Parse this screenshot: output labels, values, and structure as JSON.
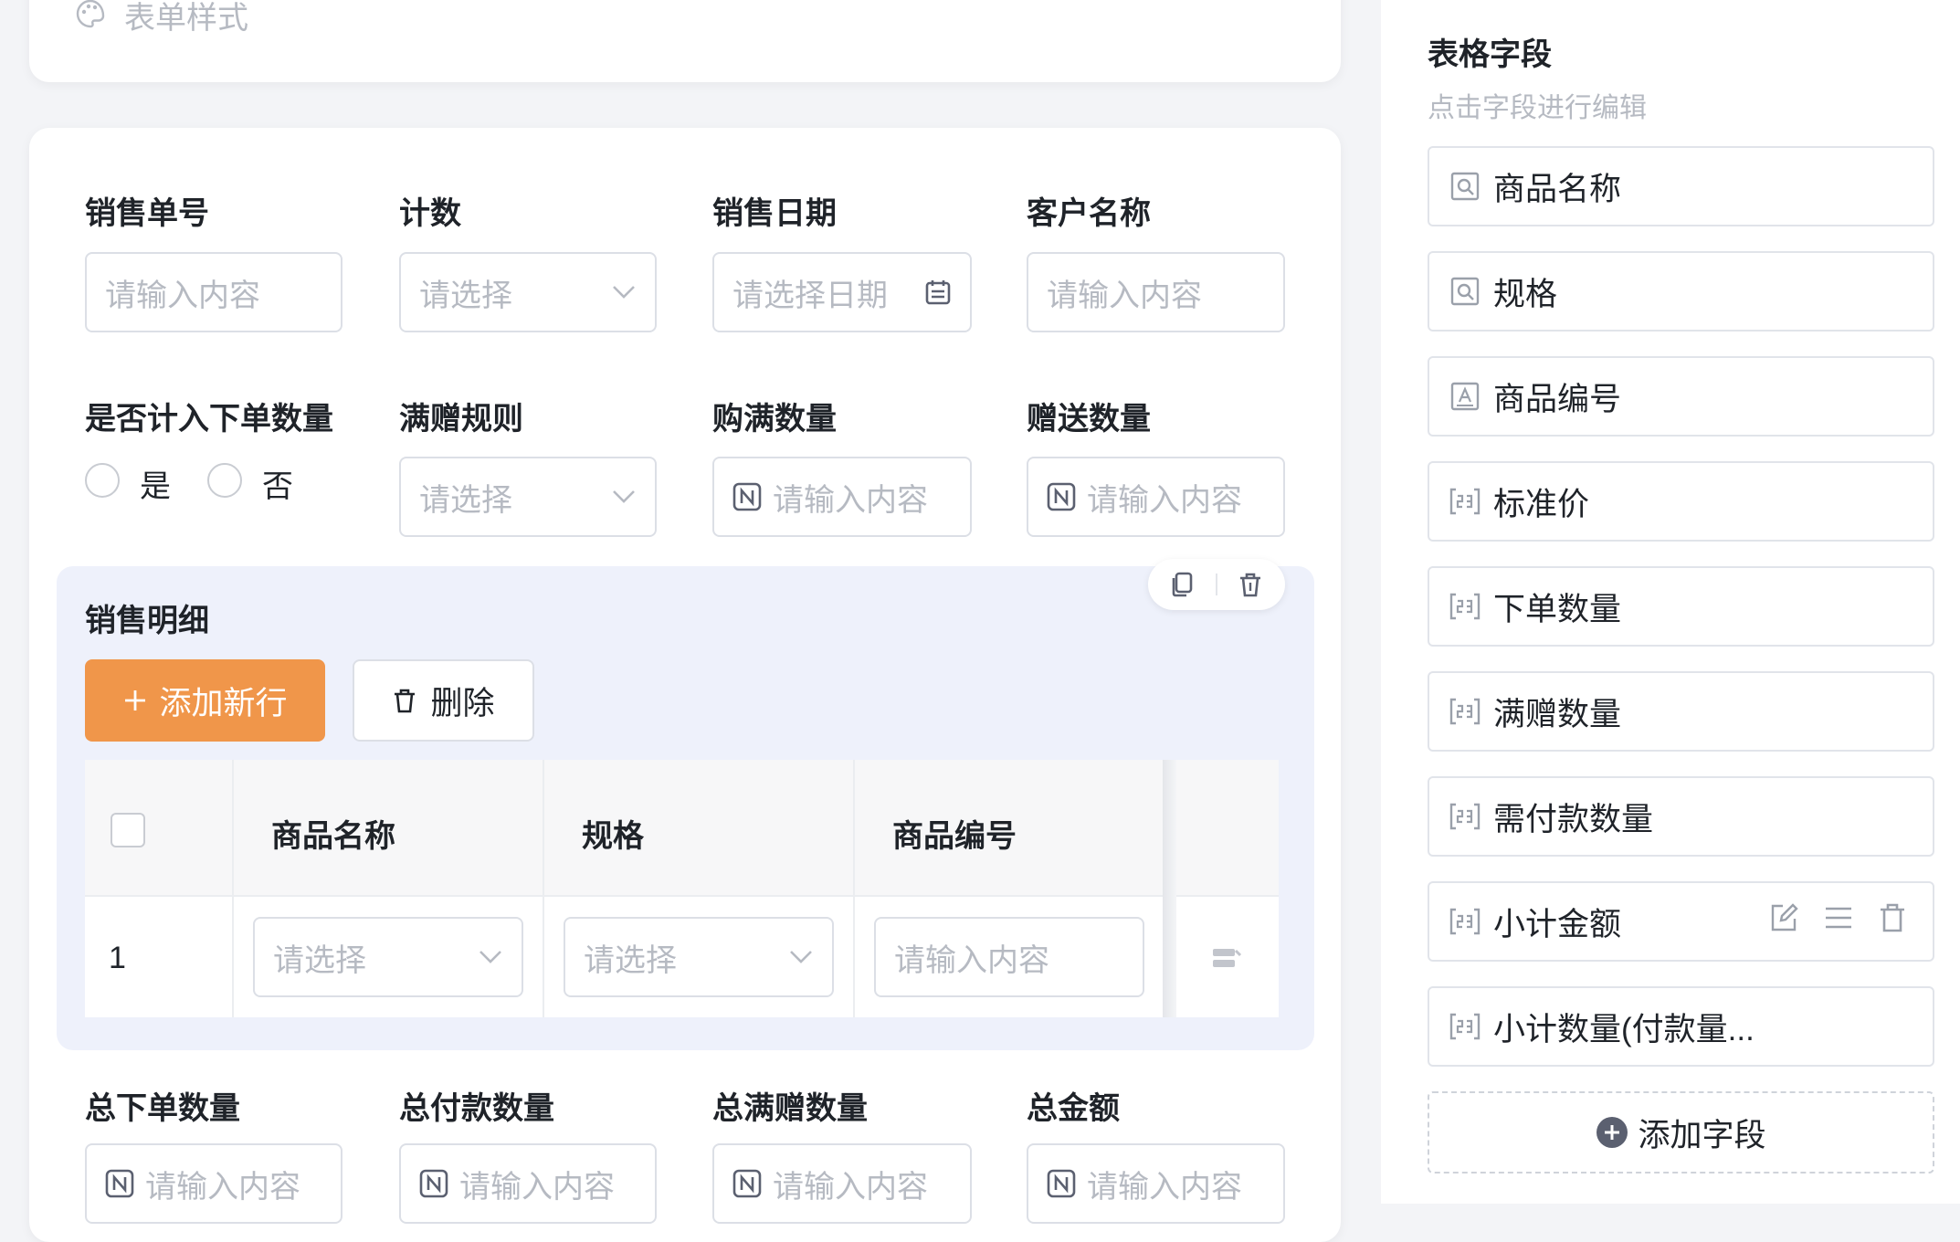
{
  "top_card": {
    "title": "表单样式",
    "icon": "palette-icon"
  },
  "form": {
    "row1": [
      {
        "label": "销售单号",
        "placeholder": "请输入内容",
        "kind": "text"
      },
      {
        "label": "计数",
        "placeholder": "请选择",
        "kind": "select"
      },
      {
        "label": "销售日期",
        "placeholder": "请选择日期",
        "kind": "date"
      },
      {
        "label": "客户名称",
        "placeholder": "请输入内容",
        "kind": "text"
      }
    ],
    "row2": {
      "radio_label": "是否计入下单数量",
      "radio_options": [
        "是",
        "否"
      ],
      "rule_label": "满赠规则",
      "rule_placeholder": "请选择",
      "buy_label": "购满数量",
      "buy_placeholder": "请输入内容",
      "gift_label": "赠送数量",
      "gift_placeholder": "请输入内容"
    },
    "detail": {
      "title": "销售明细",
      "add_button": "添加新行",
      "delete_button": "删除",
      "columns": [
        "商品名称",
        "规格",
        "商品编号"
      ],
      "row_index": "1",
      "cells": [
        "请选择",
        "请选择",
        "请输入内容"
      ]
    },
    "row3": [
      {
        "label": "总下单数量",
        "placeholder": "请输入内容"
      },
      {
        "label": "总付款数量",
        "placeholder": "请输入内容"
      },
      {
        "label": "总满赠数量",
        "placeholder": "请输入内容"
      },
      {
        "label": "总金额",
        "placeholder": "请输入内容"
      }
    ]
  },
  "sidebar": {
    "title": "表格字段",
    "subtitle": "点击字段进行编辑",
    "fields": [
      {
        "label": "商品名称",
        "icon": "search-field-icon"
      },
      {
        "label": "规格",
        "icon": "search-field-icon"
      },
      {
        "label": "商品编号",
        "icon": "text-field-icon"
      },
      {
        "label": "标准价",
        "icon": "number-field-icon"
      },
      {
        "label": "下单数量",
        "icon": "number-field-icon"
      },
      {
        "label": "满赠数量",
        "icon": "number-field-icon"
      },
      {
        "label": "需付款数量",
        "icon": "number-field-icon"
      },
      {
        "label": "小计金额",
        "icon": "number-field-icon"
      },
      {
        "label": "小计数量(付款量...",
        "icon": "number-field-icon"
      }
    ],
    "add_field": "添加字段"
  },
  "colors": {
    "accent": "#f0964a",
    "panel": "#eef1fb",
    "placeholder": "#b6bac2"
  }
}
